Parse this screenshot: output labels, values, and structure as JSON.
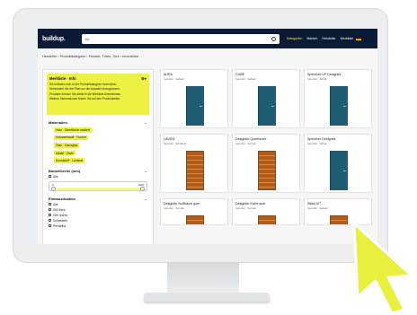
{
  "header": {
    "logo_text": "buildup",
    "search_value": "tür",
    "nav": [
      "Kategorien",
      "Marken",
      "Hersteller",
      "Merkliste"
    ]
  },
  "breadcrumb": "Hersteller › Produktkategorie › Fenster, Türen, Tore › Innentüren",
  "sidebar": {
    "note": {
      "title": "Merkliste · Info",
      "lines": [
        "Sie befinden sich in der Produktkategorie Innentüren.",
        "Verwenden Sie die Filter um die Auswahl einzugrenzen.",
        "Produkte können Sie direkt in die Merkliste übernehmen.",
        "Weitere Informationen finden Sie auf den Produktseiten."
      ]
    },
    "filters_title": "Materialien",
    "selected_tags": [
      "Holz · Oberfläche lackiert",
      "Holzwerkstoff · Furnier",
      "Glas · Ganzglas",
      "Metall · Stahl",
      "Kunststoff · Laminat"
    ],
    "range_title": "Bauteilbreite (mm)",
    "range_checkbox": "Alle",
    "range_min": "0",
    "range_max": "1000",
    "more_title": "Einbausituation",
    "checkboxes": [
      "Alle",
      "DIN links",
      "DIN rechts",
      "Schiebetür",
      "Pendeltür"
    ]
  },
  "products": [
    {
      "title": "AURA",
      "subtitle": "Innentür · lackiert",
      "door": "blue"
    },
    {
      "title": "CUBE",
      "subtitle": "Innentür · lackiert",
      "door": "blue"
    },
    {
      "title": "Spectrum UP Designtür",
      "subtitle": "Innentür · farbig",
      "door": "blue"
    },
    {
      "title": "LAVIDA",
      "subtitle": "Innentür · Echtholz",
      "door": "wood"
    },
    {
      "title": "Designtür Querfurnier",
      "subtitle": "Innentür · Furnier",
      "door": "wood"
    },
    {
      "title": "Spectrum Designtür",
      "subtitle": "Innentür · farbig",
      "door": "blue"
    },
    {
      "title": "Designtür Nußbaum quer",
      "subtitle": "Innentür · Furnier",
      "door": "wood"
    },
    {
      "title": "Designtür Eiche quer",
      "subtitle": "Innentür · Furnier",
      "door": "wood"
    },
    {
      "title": "Stiltür 6/7",
      "subtitle": "Innentür · lackiert",
      "door": "wood"
    }
  ],
  "colors": {
    "accent": "#ecf142",
    "header_bg": "#0b1b35",
    "door_blue": "#1f5d77",
    "door_wood": "#b55c1c",
    "cursor": "#e8ef3c"
  }
}
